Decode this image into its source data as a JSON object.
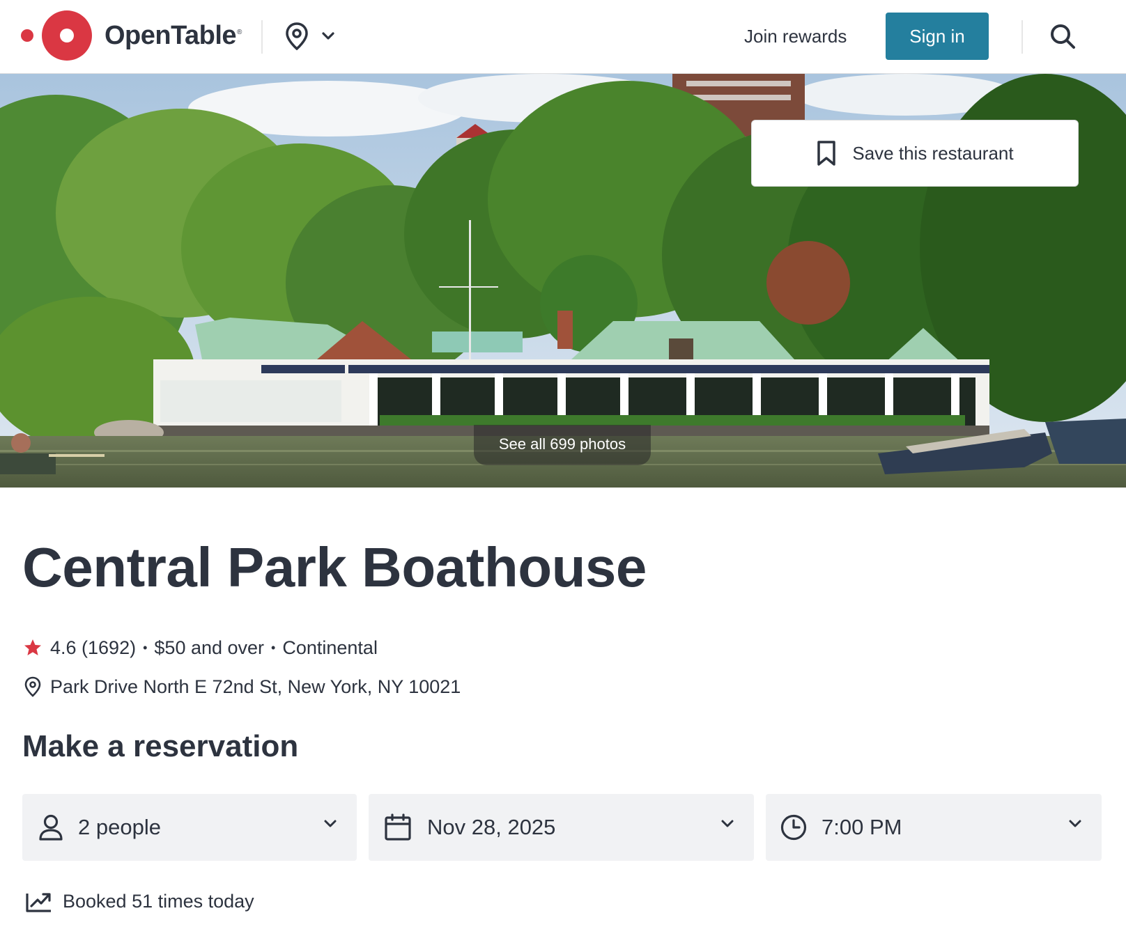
{
  "header": {
    "brand": "OpenTable",
    "brand_mark": "®",
    "join_rewards": "Join rewards",
    "sign_in": "Sign in"
  },
  "hero": {
    "save_label": "Save this restaurant",
    "photos_label": "See all 699 photos"
  },
  "restaurant": {
    "name": "Central Park Boathouse",
    "rating": "4.6 (1692)",
    "price": "$50 and over",
    "cuisine": "Continental",
    "separator": "•",
    "address": "Park Drive North E 72nd St, New York, NY 10021"
  },
  "reservation": {
    "heading": "Make a reservation",
    "party_size": "2 people",
    "date": "Nov 28, 2025",
    "time": "7:00 PM",
    "booked_today": "Booked 51 times today"
  },
  "colors": {
    "brand_red": "#da3743",
    "sign_in_teal": "#247f9e",
    "text": "#2d333f",
    "picker_bg": "#f1f2f4"
  },
  "icons": [
    "location-pin-icon",
    "chevron-down-icon",
    "search-icon",
    "bookmark-icon",
    "star-icon",
    "person-icon",
    "calendar-icon",
    "clock-icon",
    "trending-up-icon"
  ]
}
